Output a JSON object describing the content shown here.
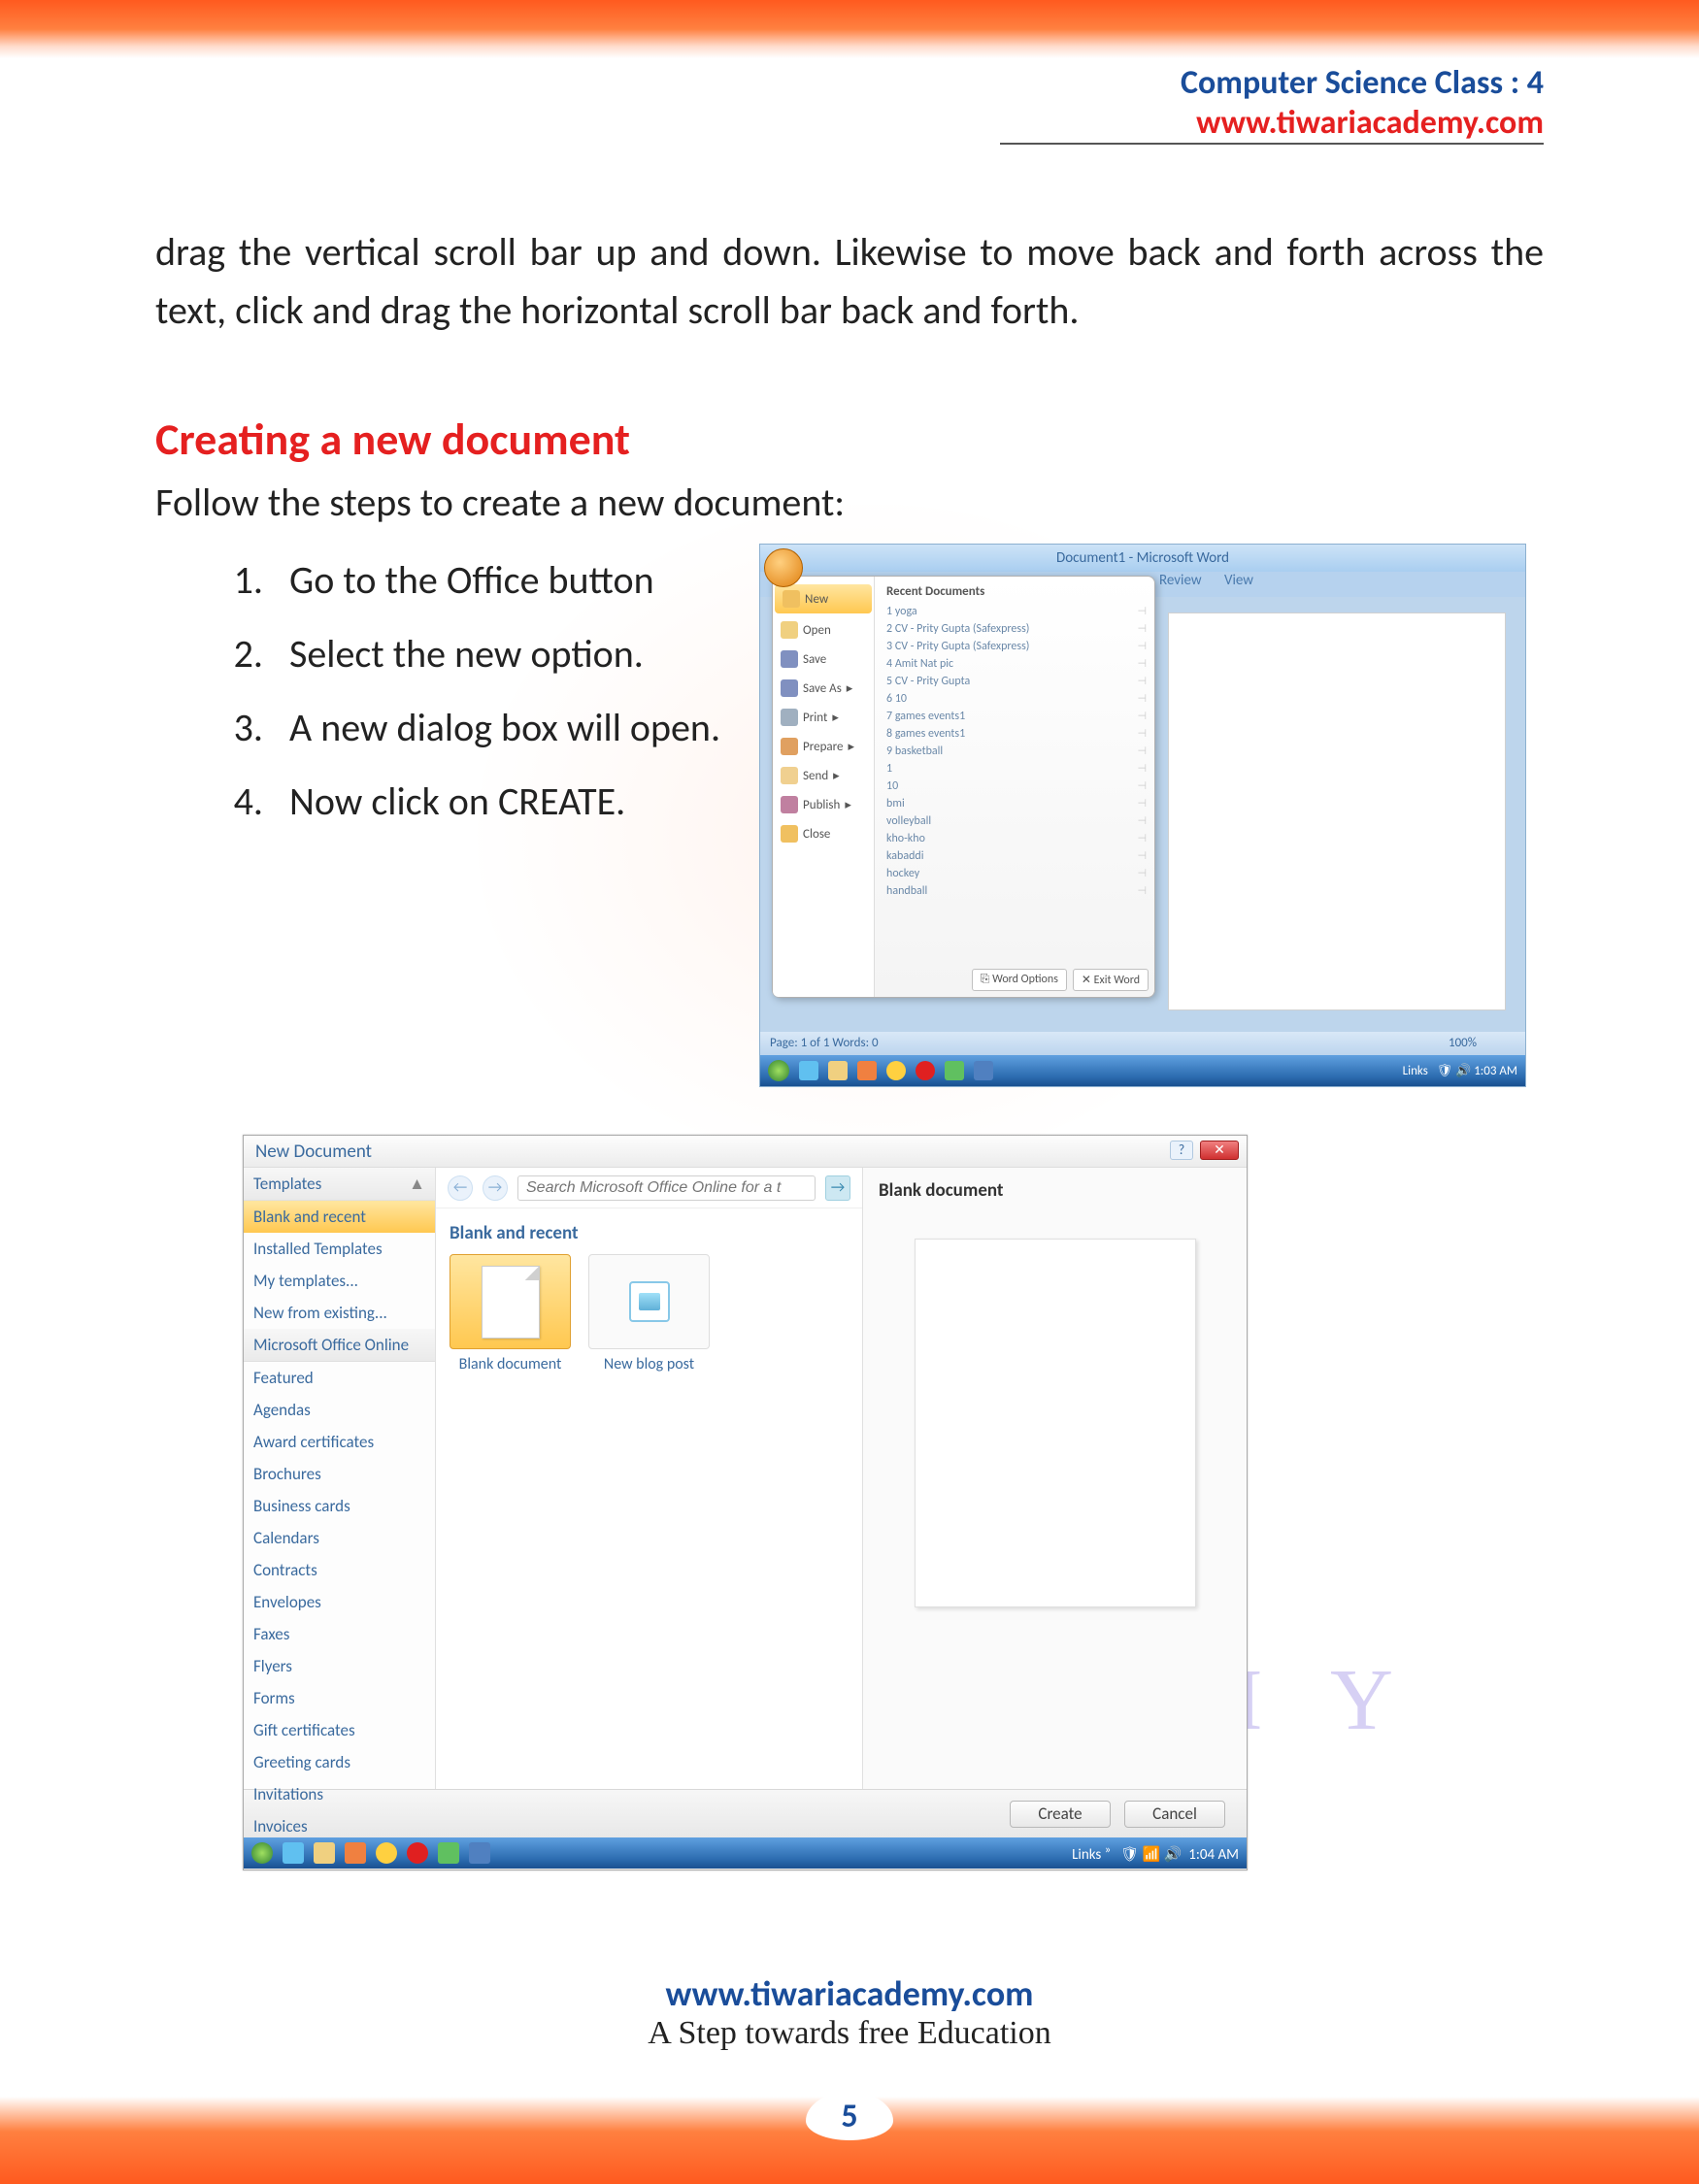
{
  "header": {
    "line1": "Computer Science Class : 4",
    "line2": "www.tiwariacademy.com"
  },
  "para1": "drag the vertical scroll bar up and down. Likewise to move back and forth across the text, click and drag the horizontal scroll bar back and forth.",
  "heading": "Creating a new document",
  "para2": "Follow the steps to create a new document:",
  "steps": [
    "Go to the Office button",
    "Select the new option.",
    "A new dialog box will open.",
    "Now click on CREATE."
  ],
  "word_window": {
    "title": "Document1 - Microsoft Word",
    "tabs": {
      "review": "Review",
      "view": "View"
    },
    "office_menu": {
      "items": [
        "New",
        "Open",
        "Save",
        "Save As",
        "Print",
        "Prepare",
        "Send",
        "Publish",
        "Close"
      ],
      "recent_header": "Recent Documents",
      "recent": [
        "1  yoga",
        "2  CV - Prity Gupta (Safexpress)",
        "3  CV - Prity Gupta (Safexpress)",
        "4  Amit Nat pic",
        "5  CV - Prity Gupta",
        "6  10",
        "7  games events1",
        "8  games events1",
        "9  basketball",
        "1",
        "10",
        "bmi",
        "volleyball",
        "kho-kho",
        "kabaddi",
        "hockey",
        "handball"
      ],
      "footer": {
        "options": "Word Options",
        "exit": "Exit Word"
      }
    },
    "statusbar": {
      "left": "Page: 1 of 1    Words: 0",
      "zoom": "100%"
    },
    "taskbar": {
      "links": "Links",
      "time": "1:03 AM"
    }
  },
  "new_doc_dialog": {
    "title": "New Document",
    "sidebar": {
      "header": "Templates",
      "items": [
        "Blank and recent",
        "Installed Templates",
        "My templates...",
        "New from existing...",
        "Microsoft Office Online",
        "Featured",
        "Agendas",
        "Award certificates",
        "Brochures",
        "Business cards",
        "Calendars",
        "Contracts",
        "Envelopes",
        "Faxes",
        "Flyers",
        "Forms",
        "Gift certificates",
        "Greeting cards",
        "Invitations",
        "Invoices"
      ]
    },
    "search_placeholder": "Search Microsoft Office Online for a t",
    "section_header": "Blank and recent",
    "templates": {
      "blank": "Blank document",
      "blog": "New blog post"
    },
    "preview_header": "Blank document",
    "buttons": {
      "create": "Create",
      "cancel": "Cancel"
    },
    "taskbar": {
      "links": "Links",
      "time": "1:04 AM"
    }
  },
  "watermark": {
    "line1": "TIWARI",
    "line2": "ACADEMY"
  },
  "footer": {
    "link": "www.tiwariacademy.com",
    "tagline": "A Step towards free Education",
    "page": "5"
  }
}
